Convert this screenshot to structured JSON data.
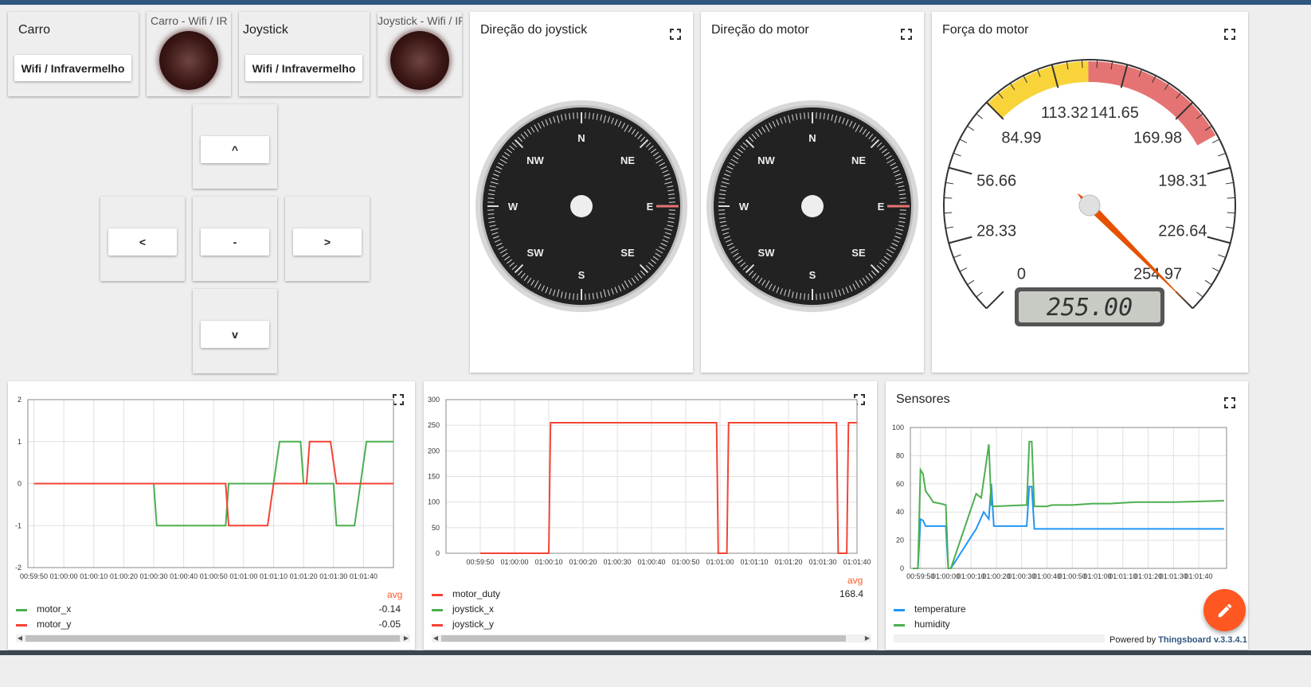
{
  "widgets": {
    "carro": {
      "title": "Carro",
      "button": "Wifi / Infravermelho"
    },
    "carro_led": {
      "title": "Carro - Wifi / IR"
    },
    "joystick": {
      "title": "Joystick",
      "button": "Wifi / Infravermelho"
    },
    "joystick_led": {
      "title": "Joystick - Wifi / IR"
    },
    "controls": {
      "up": "^",
      "left": "<",
      "stop": "-",
      "right": ">",
      "down": "v"
    }
  },
  "compass_joystick": {
    "title": "Direção do joystick",
    "labels": [
      "N",
      "NE",
      "E",
      "SE",
      "S",
      "SW",
      "W",
      "NW"
    ],
    "heading": "E"
  },
  "compass_motor": {
    "title": "Direção do motor",
    "labels": [
      "N",
      "NE",
      "E",
      "SE",
      "S",
      "SW",
      "W",
      "NW"
    ],
    "heading": "E"
  },
  "gauge": {
    "title": "Força do motor",
    "min": 0,
    "max": 255,
    "value": 255,
    "display": "255.00",
    "ticks": [
      "0",
      "28.33",
      "56.66",
      "84.99",
      "113.32",
      "141.65",
      "169.98",
      "198.31",
      "226.64",
      "254.97"
    ],
    "highlights": [
      {
        "from": 85,
        "to": 127,
        "color": "#f8d43a"
      },
      {
        "from": 127,
        "to": 185,
        "color": "#e57373"
      }
    ],
    "needle_color": "#e65100"
  },
  "chart_data": [
    {
      "type": "line",
      "title": "",
      "x": [
        "00:59:50",
        "01:00:00",
        "01:00:10",
        "01:00:20",
        "01:00:30",
        "01:00:40",
        "01:00:50",
        "01:01:00",
        "01:01:10",
        "01:01:20",
        "01:01:30",
        "01:01:40"
      ],
      "ylim": [
        -2,
        2
      ],
      "yticks": [
        "2",
        "1",
        "0",
        "-1",
        "-2"
      ],
      "grid": true,
      "legend": "bottom",
      "series": [
        {
          "name": "motor_x",
          "color": "#4caf50",
          "avg": "-0.14",
          "points": [
            [
              0,
              0
            ],
            [
              40,
              0
            ],
            [
              41,
              -1
            ],
            [
              64,
              -1
            ],
            [
              65,
              0
            ],
            [
              80,
              0
            ],
            [
              82,
              1
            ],
            [
              89,
              1
            ],
            [
              90,
              0
            ],
            [
              100,
              0
            ],
            [
              101,
              -1
            ],
            [
              107,
              -1
            ],
            [
              109,
              0
            ],
            [
              111,
              1
            ],
            [
              120,
              1
            ]
          ]
        },
        {
          "name": "motor_y",
          "color": "#f44336",
          "avg": "-0.05",
          "points": [
            [
              0,
              0
            ],
            [
              64,
              0
            ],
            [
              65,
              -1
            ],
            [
              78,
              -1
            ],
            [
              80,
              0
            ],
            [
              91,
              0
            ],
            [
              92,
              1
            ],
            [
              99,
              1
            ],
            [
              101,
              0
            ],
            [
              120,
              0
            ]
          ]
        }
      ],
      "domain": [
        -2,
        120
      ]
    },
    {
      "type": "line",
      "title": "",
      "x": [
        "00:59:50",
        "01:00:00",
        "01:00:10",
        "01:00:20",
        "01:00:30",
        "01:00:40",
        "01:00:50",
        "01:01:00",
        "01:01:10",
        "01:01:20",
        "01:01:30",
        "01:01:40"
      ],
      "ylim": [
        0,
        300
      ],
      "yticks": [
        "300",
        "250",
        "200",
        "150",
        "100",
        "50",
        "0"
      ],
      "grid": true,
      "legend": "bottom",
      "series": [
        {
          "name": "motor_duty",
          "color": "#f44336",
          "avg": "168.4",
          "points": [
            [
              0,
              0
            ],
            [
              20,
              0
            ],
            [
              20.5,
              255
            ],
            [
              69,
              255
            ],
            [
              69.5,
              0
            ],
            [
              72,
              0
            ],
            [
              72.5,
              255
            ],
            [
              104,
              255
            ],
            [
              104.5,
              0
            ],
            [
              107,
              0
            ],
            [
              107.5,
              255
            ],
            [
              110,
              255
            ]
          ]
        },
        {
          "name": "joystick_x",
          "color": "#4caf50",
          "avg": "",
          "points": []
        },
        {
          "name": "joystick_y",
          "color": "#f44336",
          "avg": "",
          "points": []
        }
      ],
      "domain": [
        -10,
        110
      ]
    },
    {
      "type": "line",
      "title": "Sensores",
      "x": [
        "00:59:50",
        "01:00:00",
        "01:00:10",
        "01:00:20",
        "01:00:30",
        "01:00:40",
        "01:00:50",
        "01:01:00",
        "01:01:10",
        "01:01:20",
        "01:01:30",
        "01:01:40"
      ],
      "ylim": [
        0,
        100
      ],
      "yticks": [
        "100",
        "80",
        "60",
        "40",
        "20",
        "0"
      ],
      "grid": true,
      "legend": "bottom",
      "series": [
        {
          "name": "temperature",
          "color": "#2196f3",
          "points": [
            [
              -3,
              0
            ],
            [
              -1,
              0
            ],
            [
              0,
              35
            ],
            [
              1,
              34
            ],
            [
              2,
              30
            ],
            [
              10,
              30
            ],
            [
              11,
              0
            ],
            [
              12,
              0
            ],
            [
              22,
              28
            ],
            [
              25,
              40
            ],
            [
              27,
              35
            ],
            [
              28,
              60
            ],
            [
              29,
              30
            ],
            [
              42,
              30
            ],
            [
              43,
              58
            ],
            [
              44,
              58
            ],
            [
              45,
              28
            ],
            [
              75,
              28
            ],
            [
              100,
              28
            ],
            [
              120,
              28
            ]
          ]
        },
        {
          "name": "humidity",
          "color": "#4caf50",
          "points": [
            [
              -3,
              0
            ],
            [
              -1,
              0
            ],
            [
              0,
              70
            ],
            [
              1,
              67
            ],
            [
              2,
              55
            ],
            [
              4,
              50
            ],
            [
              5,
              47
            ],
            [
              8,
              46
            ],
            [
              10,
              45
            ],
            [
              11,
              0
            ],
            [
              12,
              0
            ],
            [
              22,
              53
            ],
            [
              24,
              50
            ],
            [
              27,
              88
            ],
            [
              28,
              45
            ],
            [
              29,
              44
            ],
            [
              42,
              45
            ],
            [
              43,
              90
            ],
            [
              44,
              90
            ],
            [
              45,
              44
            ],
            [
              50,
              44
            ],
            [
              52,
              45
            ],
            [
              60,
              45
            ],
            [
              68,
              46
            ],
            [
              75,
              46
            ],
            [
              85,
              47
            ],
            [
              100,
              47
            ],
            [
              120,
              48
            ]
          ]
        }
      ],
      "domain": [
        -4,
        121
      ]
    }
  ],
  "footer": {
    "powered_by": "Powered by",
    "brand": "Thingsboard v.3.3.4.1"
  }
}
